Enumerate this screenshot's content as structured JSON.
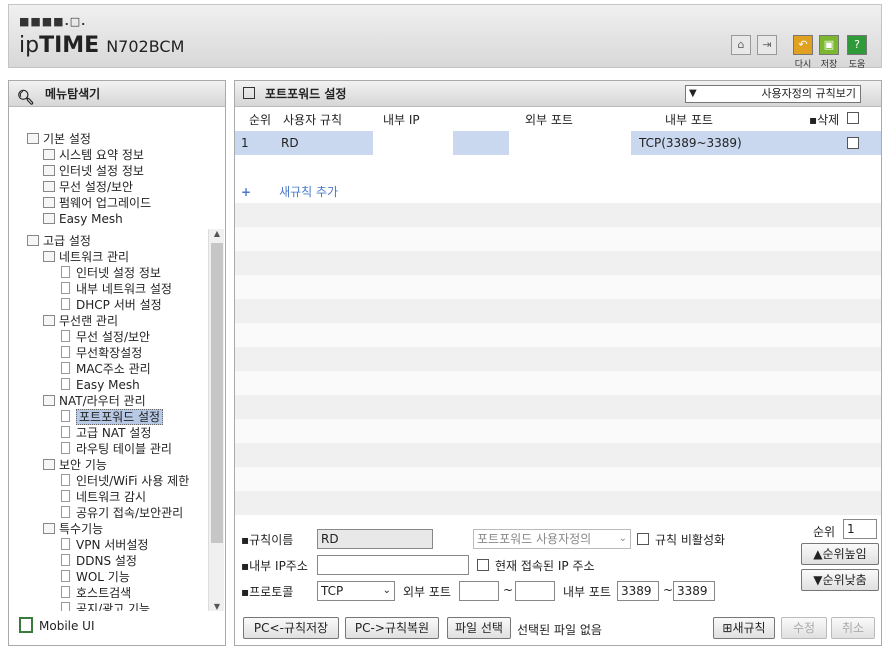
{
  "header": {
    "logo_dots": "■■■■.□.",
    "brand_a": "ip",
    "brand_b": "TIME",
    "model": "N702BCM",
    "buttons": [
      {
        "label": "다시",
        "color": "#e0a020"
      },
      {
        "label": "저장",
        "color": "#7cb82f"
      },
      {
        "label": "도움",
        "color": "#2e9a3a"
      }
    ]
  },
  "sidebar": {
    "title": "메뉴탐색기",
    "items": [
      {
        "label": "기본 설정",
        "level": 0
      },
      {
        "label": "시스템 요약 정보",
        "level": 1
      },
      {
        "label": "인터넷 설정 정보",
        "level": 1
      },
      {
        "label": "무선 설정/보안",
        "level": 1
      },
      {
        "label": "펌웨어 업그레이드",
        "level": 1
      },
      {
        "label": "Easy Mesh",
        "level": 1
      },
      {
        "label": "고급 설정",
        "level": 0
      },
      {
        "label": "네트워크 관리",
        "level": 1
      },
      {
        "label": "인터넷 설정 정보",
        "level": 2
      },
      {
        "label": "내부 네트워크 설정",
        "level": 2
      },
      {
        "label": "DHCP 서버 설정",
        "level": 2
      },
      {
        "label": "무선랜 관리",
        "level": 1
      },
      {
        "label": "무선 설정/보안",
        "level": 2
      },
      {
        "label": "무선확장설정",
        "level": 2
      },
      {
        "label": "MAC주소 관리",
        "level": 2
      },
      {
        "label": "Easy Mesh",
        "level": 2
      },
      {
        "label": "NAT/라우터 관리",
        "level": 1
      },
      {
        "label": "포트포워드 설정",
        "level": 2,
        "selected": true
      },
      {
        "label": "고급 NAT 설정",
        "level": 2
      },
      {
        "label": "라우팅 테이블 관리",
        "level": 2
      },
      {
        "label": "보안 기능",
        "level": 1
      },
      {
        "label": "인터넷/WiFi 사용 제한",
        "level": 2
      },
      {
        "label": "네트워크 감시",
        "level": 2
      },
      {
        "label": "공유기 접속/보안관리",
        "level": 2
      },
      {
        "label": "특수기능",
        "level": 1
      },
      {
        "label": "VPN 서버설정",
        "level": 2
      },
      {
        "label": "DDNS 설정",
        "level": 2
      },
      {
        "label": "WOL 기능",
        "level": 2
      },
      {
        "label": "호스트검색",
        "level": 2
      },
      {
        "label": "공지/광고 기능",
        "level": 2
      }
    ],
    "mobile_label": "Mobile UI"
  },
  "main": {
    "title": "포트포워드 설정",
    "view_select": "사용자정의 규칙보기",
    "columns": {
      "no": "순위",
      "rule": "사용자 규칙",
      "internal_ip": "내부 IP",
      "external_port": "외부 포트",
      "internal_port": "내부 포트",
      "delete": "삭제"
    },
    "rows": [
      {
        "no": "1",
        "rule": "RD",
        "internal_ip": "",
        "external_port": "",
        "internal_port": "TCP(3389~3389)"
      }
    ],
    "add_rule": "새규칙 추가",
    "form": {
      "rule_name_label": "규칙이름",
      "rule_name_value": "RD",
      "preset_select": "포트포워드 사용자정의",
      "disable_label": "규칙 비활성화",
      "internal_ip_label": "내부 IP주소",
      "current_ip_label": "현재 접속된 IP 주소",
      "protocol_label": "프로토콜",
      "protocol_value": "TCP",
      "external_port_label": "외부 포트",
      "tilde": "~",
      "internal_port_label": "내부 포트",
      "internal_port_from": "3389",
      "internal_port_to": "3389",
      "rank_label": "순위",
      "rank_value": "1",
      "up_button": "▲순위높임",
      "down_button": "▼순위낮춤",
      "save_pc_button": "PC<-규칙저장",
      "restore_pc_button": "PC->규칙복원",
      "file_button": "파일 선택",
      "file_status": "선택된 파일 없음",
      "new_rule_button": "⊞새규칙",
      "modify_button": "수정",
      "cancel_button": "취소"
    }
  }
}
